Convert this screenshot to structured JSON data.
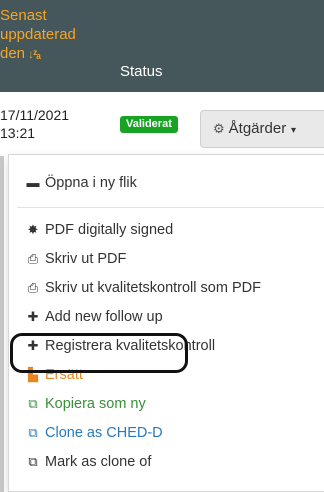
{
  "header": {
    "updated_lines": [
      "Senast",
      "uppdaterad",
      "den"
    ],
    "sort_icon": "↓ᶻₐ",
    "status_label": "Status"
  },
  "row": {
    "date_line1": "17/11/2021",
    "date_line2": "13:21",
    "status_badge": "Validerat",
    "actions_label": "Åtgärder"
  },
  "menu": {
    "items": [
      {
        "icon": "window-icon",
        "glyph": "▬",
        "label": "Öppna i ny flik"
      },
      {
        "icon": "seal-icon",
        "glyph": "✸",
        "label": "PDF digitally signed"
      },
      {
        "icon": "pdf-icon",
        "glyph": "⎙",
        "label": "Skriv ut PDF"
      },
      {
        "icon": "pdf-icon",
        "glyph": "⎙",
        "label": "Skriv ut kvalitetskontroll som PDF"
      },
      {
        "icon": "plus-icon",
        "glyph": "✚",
        "label": "Add new follow up"
      },
      {
        "icon": "plus-icon",
        "glyph": "✚",
        "label": "Registrera kvalitetskontroll"
      },
      {
        "icon": "replace-icon",
        "glyph": "▙",
        "label": "Ersätt"
      },
      {
        "icon": "copy-icon",
        "glyph": "⧉",
        "label": "Kopiera som ny"
      },
      {
        "icon": "clone-icon",
        "glyph": "⧉",
        "label": "Clone as CHED-D"
      },
      {
        "icon": "clone-icon",
        "glyph": "⧉",
        "label": "Mark as clone of"
      }
    ]
  },
  "colors": {
    "header_bg": "#46575b",
    "header_accent": "#f5a524",
    "badge_green": "#18a325",
    "orange_item": "#e8861f",
    "green_item": "#3a8f3a",
    "blue_item": "#2779bd"
  }
}
